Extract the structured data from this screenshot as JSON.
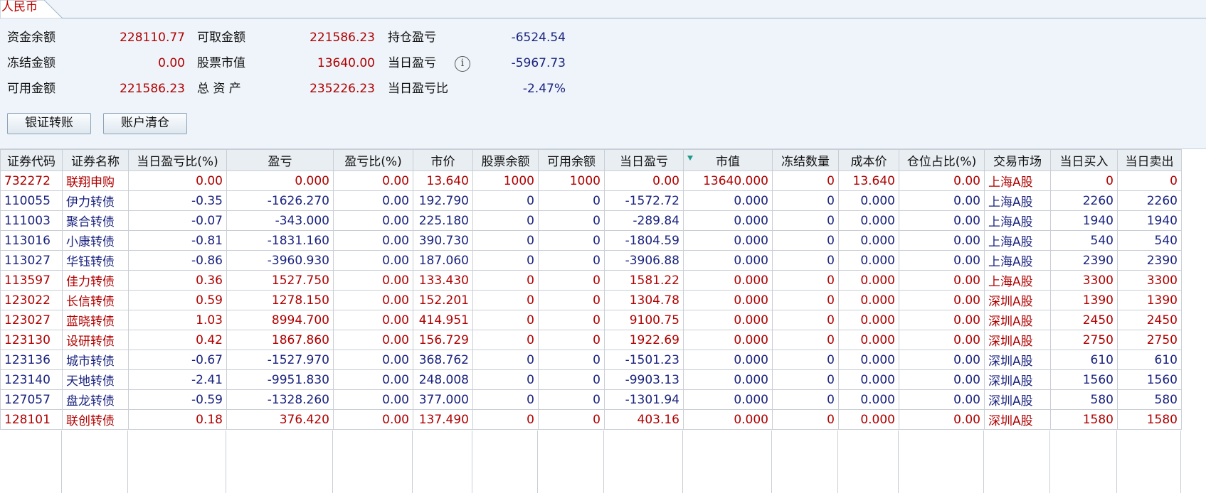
{
  "tab": {
    "label": "人民币"
  },
  "summary": {
    "fund_balance_label": "资金余额",
    "fund_balance": "228110.77",
    "frozen_label": "冻结金额",
    "frozen": "0.00",
    "available_label": "可用金额",
    "available": "221586.23",
    "withdrawable_label": "可取金额",
    "withdrawable": "221586.23",
    "stock_value_label": "股票市值",
    "stock_value": "13640.00",
    "total_assets_label": "总 资 产",
    "total_assets": "235226.23",
    "position_pl_label": "持仓盈亏",
    "position_pl": "-6524.54",
    "daily_pl_label": "当日盈亏",
    "daily_pl": "-5967.73",
    "daily_pl_ratio_label": "当日盈亏比",
    "daily_pl_ratio": "-2.47%",
    "info_icon": "i"
  },
  "buttons": {
    "bank_transfer": "银证转账",
    "clear_account": "账户清仓"
  },
  "colors": {
    "up": "#b00000",
    "down": "#1a237e",
    "panel_bg": "#eef4f9"
  },
  "table": {
    "headers": [
      "证券代码",
      "证券名称",
      "当日盈亏比(%)",
      "盈亏",
      "盈亏比(%)",
      "市价",
      "股票余额",
      "可用余额",
      "当日盈亏",
      "市值",
      "冻结数量",
      "成本价",
      "仓位占比(%)",
      "交易市场",
      "当日买入",
      "当日卖出"
    ],
    "rows": [
      {
        "dir": "up",
        "cells": [
          "732272",
          "联翔申购",
          "0.00",
          "0.000",
          "0.00",
          "13.640",
          "1000",
          "1000",
          "0.00",
          "13640.000",
          "0",
          "13.640",
          "0.00",
          "上海A股",
          "0",
          "0"
        ]
      },
      {
        "dir": "dn",
        "cells": [
          "110055",
          "伊力转债",
          "-0.35",
          "-1626.270",
          "0.00",
          "192.790",
          "0",
          "0",
          "-1572.72",
          "0.000",
          "0",
          "0.000",
          "0.00",
          "上海A股",
          "2260",
          "2260"
        ]
      },
      {
        "dir": "dn",
        "cells": [
          "111003",
          "聚合转债",
          "-0.07",
          "-343.000",
          "0.00",
          "225.180",
          "0",
          "0",
          "-289.84",
          "0.000",
          "0",
          "0.000",
          "0.00",
          "上海A股",
          "1940",
          "1940"
        ]
      },
      {
        "dir": "dn",
        "cells": [
          "113016",
          "小康转债",
          "-0.81",
          "-1831.160",
          "0.00",
          "390.730",
          "0",
          "0",
          "-1804.59",
          "0.000",
          "0",
          "0.000",
          "0.00",
          "上海A股",
          "540",
          "540"
        ]
      },
      {
        "dir": "dn",
        "cells": [
          "113027",
          "华钰转债",
          "-0.86",
          "-3960.930",
          "0.00",
          "187.060",
          "0",
          "0",
          "-3906.88",
          "0.000",
          "0",
          "0.000",
          "0.00",
          "上海A股",
          "2390",
          "2390"
        ]
      },
      {
        "dir": "up",
        "cells": [
          "113597",
          "佳力转债",
          "0.36",
          "1527.750",
          "0.00",
          "133.430",
          "0",
          "0",
          "1581.22",
          "0.000",
          "0",
          "0.000",
          "0.00",
          "上海A股",
          "3300",
          "3300"
        ]
      },
      {
        "dir": "up",
        "cells": [
          "123022",
          "长信转债",
          "0.59",
          "1278.150",
          "0.00",
          "152.201",
          "0",
          "0",
          "1304.78",
          "0.000",
          "0",
          "0.000",
          "0.00",
          "深圳A股",
          "1390",
          "1390"
        ]
      },
      {
        "dir": "up",
        "cells": [
          "123027",
          "蓝晓转债",
          "1.03",
          "8994.700",
          "0.00",
          "414.951",
          "0",
          "0",
          "9100.75",
          "0.000",
          "0",
          "0.000",
          "0.00",
          "深圳A股",
          "2450",
          "2450"
        ]
      },
      {
        "dir": "up",
        "cells": [
          "123130",
          "设研转债",
          "0.42",
          "1867.860",
          "0.00",
          "156.729",
          "0",
          "0",
          "1922.69",
          "0.000",
          "0",
          "0.000",
          "0.00",
          "深圳A股",
          "2750",
          "2750"
        ]
      },
      {
        "dir": "dn",
        "cells": [
          "123136",
          "城市转债",
          "-0.67",
          "-1527.970",
          "0.00",
          "368.762",
          "0",
          "0",
          "-1501.23",
          "0.000",
          "0",
          "0.000",
          "0.00",
          "深圳A股",
          "610",
          "610"
        ]
      },
      {
        "dir": "dn",
        "cells": [
          "123140",
          "天地转债",
          "-2.41",
          "-9951.830",
          "0.00",
          "248.008",
          "0",
          "0",
          "-9903.13",
          "0.000",
          "0",
          "0.000",
          "0.00",
          "深圳A股",
          "1560",
          "1560"
        ]
      },
      {
        "dir": "dn",
        "cells": [
          "127057",
          "盘龙转债",
          "-0.59",
          "-1328.260",
          "0.00",
          "377.000",
          "0",
          "0",
          "-1301.94",
          "0.000",
          "0",
          "0.000",
          "0.00",
          "深圳A股",
          "580",
          "580"
        ]
      },
      {
        "dir": "up",
        "cells": [
          "128101",
          "联创转债",
          "0.18",
          "376.420",
          "0.00",
          "137.490",
          "0",
          "0",
          "403.16",
          "0.000",
          "0",
          "0.000",
          "0.00",
          "深圳A股",
          "1580",
          "1580"
        ]
      }
    ]
  }
}
